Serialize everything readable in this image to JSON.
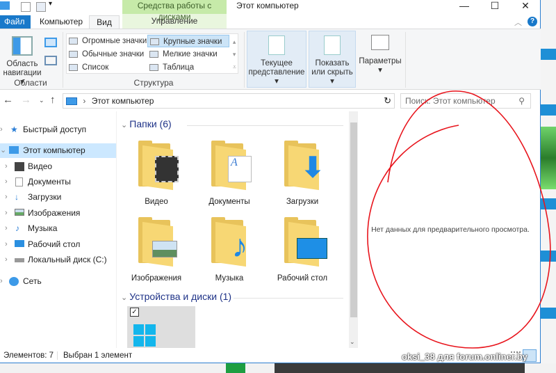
{
  "titlebar": {
    "title": "Этот компьютер",
    "context_tab_group": "Средства работы с дисками"
  },
  "tabs": {
    "file": "Файл",
    "computer": "Компьютер",
    "view": "Вид",
    "manage": "Управление"
  },
  "ribbon": {
    "areas": {
      "nav_pane": "Область навигации",
      "label": "Области"
    },
    "layout": {
      "items": [
        "Огромные значки",
        "Крупные значки",
        "Обычные значки",
        "Мелкие значки",
        "Список",
        "Таблица"
      ],
      "selected": "Крупные значки",
      "label": "Структура"
    },
    "current_view": "Текущее представление",
    "show_hide": "Показать или скрыть",
    "options": "Параметры"
  },
  "address": {
    "path": "Этот компьютер",
    "search_placeholder": "Поиск: Этот компьютер"
  },
  "navpane": {
    "quick_access": "Быстрый доступ",
    "this_pc": "Этот компьютер",
    "children": [
      "Видео",
      "Документы",
      "Загрузки",
      "Изображения",
      "Музыка",
      "Рабочий стол",
      "Локальный диск (C:)"
    ],
    "network": "Сеть"
  },
  "content": {
    "folders_header": "Папки (6)",
    "folders": [
      "Видео",
      "Документы",
      "Загрузки",
      "Изображения",
      "Музыка",
      "Рабочий стол"
    ],
    "devices_header": "Устройства и диски (1)"
  },
  "preview": {
    "empty_text": "Нет данных для предварительного просмотра."
  },
  "status": {
    "items": "Элементов: 7",
    "selected": "Выбран 1 элемент"
  },
  "watermark": "oksi_38 для forum.onliner.by",
  "colors": {
    "accent": "#1979ca",
    "annotation": "#e8141c",
    "context_tab": "#c6eaa9"
  }
}
